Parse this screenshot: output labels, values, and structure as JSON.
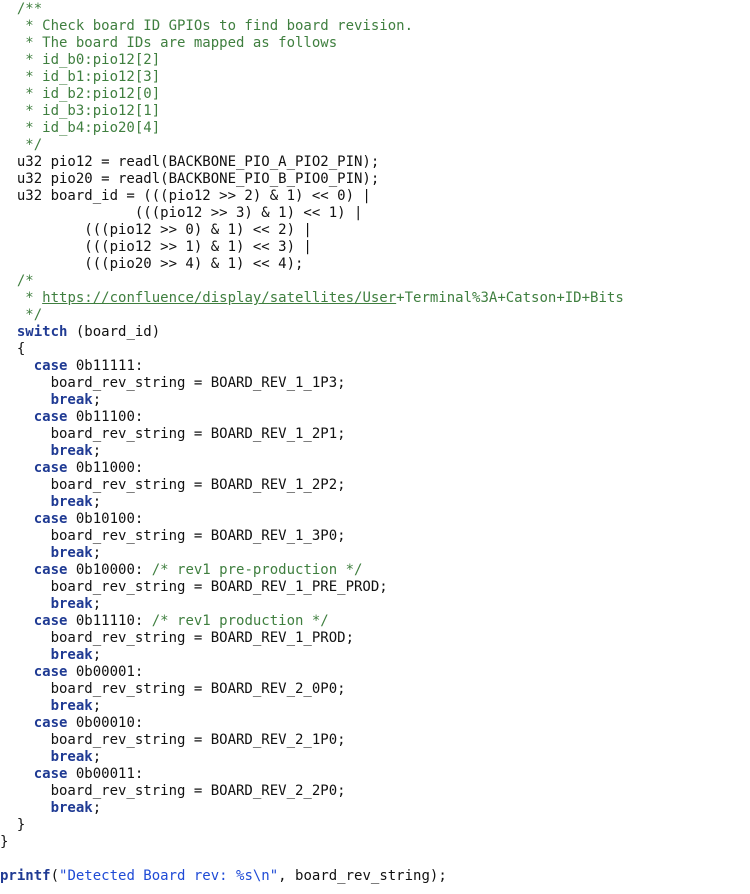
{
  "code": {
    "lines": [
      {
        "segments": [
          {
            "text": "  /**",
            "type": "comment"
          }
        ]
      },
      {
        "segments": [
          {
            "text": "   * Check board ID GPIOs to find board revision.",
            "type": "comment"
          }
        ]
      },
      {
        "segments": [
          {
            "text": "   * The board IDs are mapped as follows",
            "type": "comment"
          }
        ]
      },
      {
        "segments": [
          {
            "text": "   * id_b0:pio12[2]",
            "type": "comment"
          }
        ]
      },
      {
        "segments": [
          {
            "text": "   * id_b1:pio12[3]",
            "type": "comment"
          }
        ]
      },
      {
        "segments": [
          {
            "text": "   * id_b2:pio12[0]",
            "type": "comment"
          }
        ]
      },
      {
        "segments": [
          {
            "text": "   * id_b3:pio12[1]",
            "type": "comment"
          }
        ]
      },
      {
        "segments": [
          {
            "text": "   * id_b4:pio20[4]",
            "type": "comment"
          }
        ]
      },
      {
        "segments": [
          {
            "text": "   */",
            "type": "comment"
          }
        ]
      },
      {
        "segments": [
          {
            "text": "  u32 pio12 = readl(BACKBONE_PIO_A_PIO2_PIN);",
            "type": "plain"
          }
        ]
      },
      {
        "segments": [
          {
            "text": "  u32 pio20 = readl(BACKBONE_PIO_B_PIO0_PIN);",
            "type": "plain"
          }
        ]
      },
      {
        "segments": [
          {
            "text": "  u32 board_id = (((pio12 >> 2) & 1) << 0) |",
            "type": "plain"
          }
        ]
      },
      {
        "segments": [
          {
            "text": "                (((pio12 >> 3) & 1) << 1) |",
            "type": "plain"
          }
        ]
      },
      {
        "segments": [
          {
            "text": "          (((pio12 >> 0) & 1) << 2) |",
            "type": "plain"
          }
        ]
      },
      {
        "segments": [
          {
            "text": "          (((pio12 >> 1) & 1) << 3) |",
            "type": "plain"
          }
        ]
      },
      {
        "segments": [
          {
            "text": "          (((pio20 >> 4) & 1) << 4);",
            "type": "plain"
          }
        ]
      },
      {
        "segments": [
          {
            "text": "  /*",
            "type": "comment"
          }
        ]
      },
      {
        "segments": [
          {
            "text": "   * ",
            "type": "comment"
          },
          {
            "text": "https://confluence/display/satellites/User",
            "type": "link"
          },
          {
            "text": "+Terminal%3A+Catson+ID+Bits",
            "type": "comment"
          }
        ]
      },
      {
        "segments": [
          {
            "text": "   */",
            "type": "comment"
          }
        ]
      },
      {
        "segments": [
          {
            "text": "  ",
            "type": "plain"
          },
          {
            "text": "switch",
            "type": "keyword"
          },
          {
            "text": " (board_id)",
            "type": "plain"
          }
        ]
      },
      {
        "segments": [
          {
            "text": "  {",
            "type": "plain"
          }
        ]
      },
      {
        "segments": [
          {
            "text": "    ",
            "type": "plain"
          },
          {
            "text": "case",
            "type": "keyword"
          },
          {
            "text": " 0b11111:",
            "type": "plain"
          }
        ]
      },
      {
        "segments": [
          {
            "text": "      board_rev_string = BOARD_REV_1_1P3;",
            "type": "plain"
          }
        ]
      },
      {
        "segments": [
          {
            "text": "      ",
            "type": "plain"
          },
          {
            "text": "break",
            "type": "keyword"
          },
          {
            "text": ";",
            "type": "plain"
          }
        ]
      },
      {
        "segments": [
          {
            "text": "    ",
            "type": "plain"
          },
          {
            "text": "case",
            "type": "keyword"
          },
          {
            "text": " 0b11100:",
            "type": "plain"
          }
        ]
      },
      {
        "segments": [
          {
            "text": "      board_rev_string = BOARD_REV_1_2P1;",
            "type": "plain"
          }
        ]
      },
      {
        "segments": [
          {
            "text": "      ",
            "type": "plain"
          },
          {
            "text": "break",
            "type": "keyword"
          },
          {
            "text": ";",
            "type": "plain"
          }
        ]
      },
      {
        "segments": [
          {
            "text": "    ",
            "type": "plain"
          },
          {
            "text": "case",
            "type": "keyword"
          },
          {
            "text": " 0b11000:",
            "type": "plain"
          }
        ]
      },
      {
        "segments": [
          {
            "text": "      board_rev_string = BOARD_REV_1_2P2;",
            "type": "plain"
          }
        ]
      },
      {
        "segments": [
          {
            "text": "      ",
            "type": "plain"
          },
          {
            "text": "break",
            "type": "keyword"
          },
          {
            "text": ";",
            "type": "plain"
          }
        ]
      },
      {
        "segments": [
          {
            "text": "    ",
            "type": "plain"
          },
          {
            "text": "case",
            "type": "keyword"
          },
          {
            "text": " 0b10100:",
            "type": "plain"
          }
        ]
      },
      {
        "segments": [
          {
            "text": "      board_rev_string = BOARD_REV_1_3P0;",
            "type": "plain"
          }
        ]
      },
      {
        "segments": [
          {
            "text": "      ",
            "type": "plain"
          },
          {
            "text": "break",
            "type": "keyword"
          },
          {
            "text": ";",
            "type": "plain"
          }
        ]
      },
      {
        "segments": [
          {
            "text": "    ",
            "type": "plain"
          },
          {
            "text": "case",
            "type": "keyword"
          },
          {
            "text": " 0b10000: ",
            "type": "plain"
          },
          {
            "text": "/* rev1 pre-production */",
            "type": "comment"
          }
        ]
      },
      {
        "segments": [
          {
            "text": "      board_rev_string = BOARD_REV_1_PRE_PROD;",
            "type": "plain"
          }
        ]
      },
      {
        "segments": [
          {
            "text": "      ",
            "type": "plain"
          },
          {
            "text": "break",
            "type": "keyword"
          },
          {
            "text": ";",
            "type": "plain"
          }
        ]
      },
      {
        "segments": [
          {
            "text": "    ",
            "type": "plain"
          },
          {
            "text": "case",
            "type": "keyword"
          },
          {
            "text": " 0b11110: ",
            "type": "plain"
          },
          {
            "text": "/* rev1 production */",
            "type": "comment"
          }
        ]
      },
      {
        "segments": [
          {
            "text": "      board_rev_string = BOARD_REV_1_PROD;",
            "type": "plain"
          }
        ]
      },
      {
        "segments": [
          {
            "text": "      ",
            "type": "plain"
          },
          {
            "text": "break",
            "type": "keyword"
          },
          {
            "text": ";",
            "type": "plain"
          }
        ]
      },
      {
        "segments": [
          {
            "text": "    ",
            "type": "plain"
          },
          {
            "text": "case",
            "type": "keyword"
          },
          {
            "text": " 0b00001:",
            "type": "plain"
          }
        ]
      },
      {
        "segments": [
          {
            "text": "      board_rev_string = BOARD_REV_2_0P0;",
            "type": "plain"
          }
        ]
      },
      {
        "segments": [
          {
            "text": "      ",
            "type": "plain"
          },
          {
            "text": "break",
            "type": "keyword"
          },
          {
            "text": ";",
            "type": "plain"
          }
        ]
      },
      {
        "segments": [
          {
            "text": "    ",
            "type": "plain"
          },
          {
            "text": "case",
            "type": "keyword"
          },
          {
            "text": " 0b00010:",
            "type": "plain"
          }
        ]
      },
      {
        "segments": [
          {
            "text": "      board_rev_string = BOARD_REV_2_1P0;",
            "type": "plain"
          }
        ]
      },
      {
        "segments": [
          {
            "text": "      ",
            "type": "plain"
          },
          {
            "text": "break",
            "type": "keyword"
          },
          {
            "text": ";",
            "type": "plain"
          }
        ]
      },
      {
        "segments": [
          {
            "text": "    ",
            "type": "plain"
          },
          {
            "text": "case",
            "type": "keyword"
          },
          {
            "text": " 0b00011:",
            "type": "plain"
          }
        ]
      },
      {
        "segments": [
          {
            "text": "      board_rev_string = BOARD_REV_2_2P0;",
            "type": "plain"
          }
        ]
      },
      {
        "segments": [
          {
            "text": "      ",
            "type": "plain"
          },
          {
            "text": "break",
            "type": "keyword"
          },
          {
            "text": ";",
            "type": "plain"
          }
        ]
      },
      {
        "segments": [
          {
            "text": "  }",
            "type": "plain"
          }
        ]
      },
      {
        "segments": [
          {
            "text": "}",
            "type": "plain"
          }
        ]
      },
      {
        "segments": [
          {
            "text": "",
            "type": "plain"
          }
        ]
      },
      {
        "segments": [
          {
            "text": "printf",
            "type": "keyword"
          },
          {
            "text": "(",
            "type": "plain"
          },
          {
            "text": "\"Detected Board rev: %s\\n\"",
            "type": "string"
          },
          {
            "text": ", board_rev_string);",
            "type": "plain"
          }
        ]
      }
    ]
  },
  "colors": {
    "comment": "#3f7f3f",
    "keyword": "#1f3a93",
    "string": "#1f4bd6",
    "plain": "#111111",
    "background": "#ffffff"
  }
}
